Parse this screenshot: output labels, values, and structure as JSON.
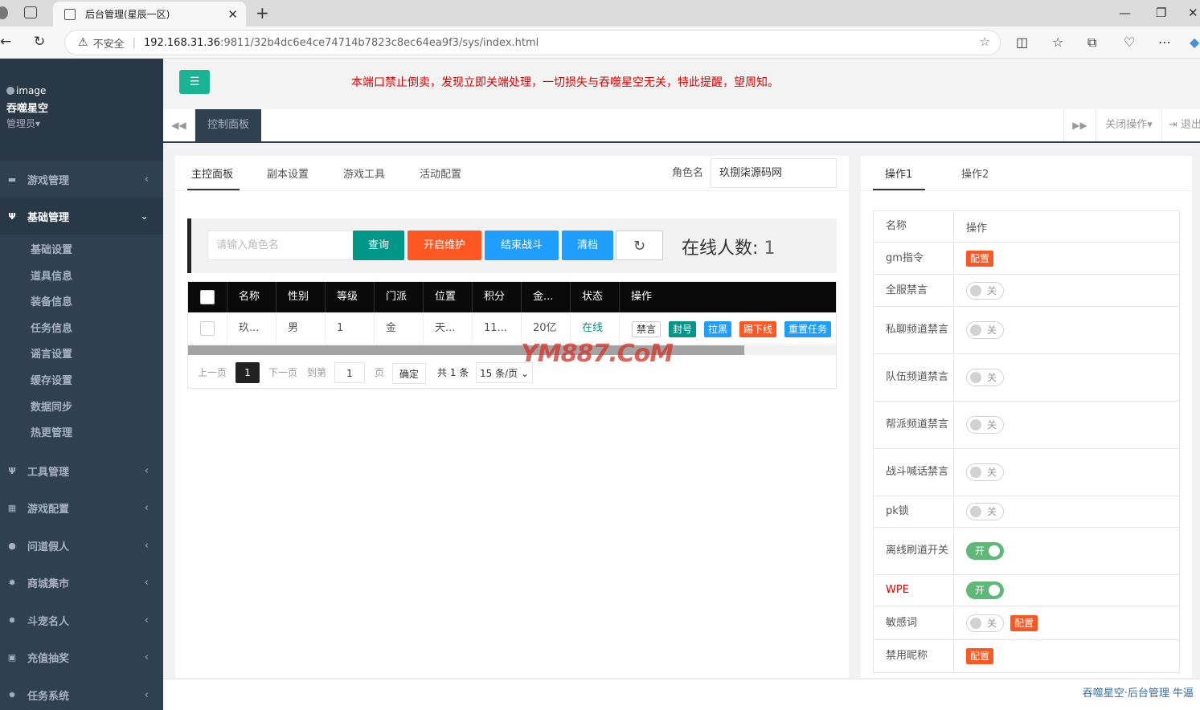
{
  "browser": {
    "tab_title": "后台管理(星辰一区)",
    "tab_close": "✕",
    "new_tab": "+",
    "insecure_label": "不安全",
    "url_host": "192.168.31.36",
    "url_path": ":9811/32b4dc6e4ce74714b7823c8ec64ea9f3/sys/index.html"
  },
  "sidebar": {
    "image_alt": "image",
    "user_name": "吞噬星空",
    "role": "管理员▾",
    "menu": [
      {
        "label": "游戏管理",
        "icon": "gamepad-icon"
      },
      {
        "label": "基础管理",
        "icon": "cutlery-icon"
      },
      {
        "label": "工具管理",
        "icon": "cutlery-icon"
      },
      {
        "label": "游戏配置",
        "icon": "table-icon"
      },
      {
        "label": "问道假人",
        "icon": "user-icon"
      },
      {
        "label": "商城集市",
        "icon": "gear-icon"
      },
      {
        "label": "斗宠名人",
        "icon": "gear-icon"
      },
      {
        "label": "充值抽奖",
        "icon": "gift-icon"
      },
      {
        "label": "任务系统",
        "icon": "gear-icon"
      }
    ],
    "submenu": [
      "基础设置",
      "道具信息",
      "装备信息",
      "任务信息",
      "谣言设置",
      "缓存设置",
      "数据同步",
      "热更管理"
    ]
  },
  "topbar": {
    "notice": "本端口禁止倒卖，发现立即关端处理，一切损失与吞噬星空无关，特此提醒，望周知。"
  },
  "tabsbar": {
    "active_tab": "控制面板",
    "close_ops": "关闭操作▾",
    "exit": "⇥ 退出"
  },
  "main": {
    "tabs": [
      "主控面板",
      "副本设置",
      "游戏工具",
      "活动配置"
    ],
    "role_label": "角色名",
    "role_value": "玖捌柒源码网",
    "search_placeholder": "请输入角色名",
    "buttons": {
      "query": "查询",
      "maintain": "开启维护",
      "end_battle": "结束战斗",
      "clear": "清档",
      "refresh": "↻"
    },
    "online_label": "在线人数:",
    "online_count": "1",
    "columns": [
      "名称",
      "性别",
      "等级",
      "门派",
      "位置",
      "积分",
      "金...",
      "状态",
      "操作"
    ],
    "rows": [
      {
        "name": "玖...",
        "gender": "男",
        "level": "1",
        "faction": "金",
        "location": "天...",
        "score": "11...",
        "gold": "20亿",
        "status": "在线",
        "actions": [
          "禁言",
          "封号",
          "拉黑",
          "踢下线",
          "重置任务"
        ]
      }
    ],
    "pager": {
      "prev": "上一页",
      "current": "1",
      "next": "下一页",
      "goto": "到第",
      "goto_value": "1",
      "page_unit": "页",
      "confirm": "确定",
      "total": "共 1 条",
      "page_size": "15 条/页"
    },
    "watermark": "YM887.CoM"
  },
  "right": {
    "tabs": [
      "操作1",
      "操作2"
    ],
    "header": {
      "name": "名称",
      "op": "操作"
    },
    "off_text": "关",
    "on_text": "开",
    "config_text": "配置",
    "rows": [
      {
        "name": "gm指令",
        "type": "config"
      },
      {
        "name": "全服禁言",
        "type": "switch",
        "on": false
      },
      {
        "name": "私聊频道禁言",
        "type": "switch",
        "on": false
      },
      {
        "name": "队伍频道禁言",
        "type": "switch",
        "on": false
      },
      {
        "name": "帮派频道禁言",
        "type": "switch",
        "on": false
      },
      {
        "name": "战斗喊话禁言",
        "type": "switch",
        "on": false
      },
      {
        "name": "pk锁",
        "type": "switch",
        "on": false
      },
      {
        "name": "离线刷道开关",
        "type": "switch",
        "on": true
      },
      {
        "name": "WPE",
        "type": "switch",
        "on": true,
        "red": true
      },
      {
        "name": "敏感词",
        "type": "switch_config",
        "on": false
      },
      {
        "name": "禁用昵称",
        "type": "config"
      }
    ]
  },
  "footer": {
    "text": "吞噬星空·后台管理 牛逼"
  },
  "colors": {
    "sidebar": "#2f4050",
    "primary_green": "#009688",
    "toggle_green": "#1ab394",
    "orange": "#ff5722",
    "blue": "#1e9fff",
    "notice_red": "#e10000"
  }
}
